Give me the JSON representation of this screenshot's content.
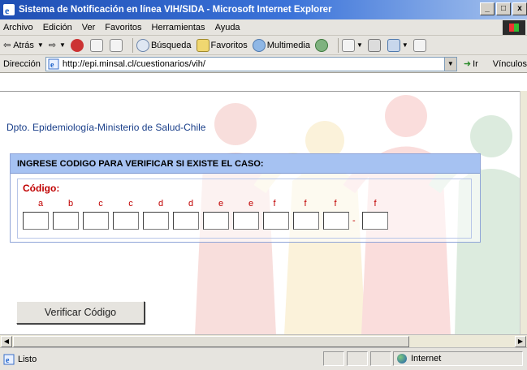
{
  "window": {
    "title": "Sistema de Notificación en línea VIH/SIDA - Microsoft Internet Explorer",
    "controls": [
      "_",
      "□",
      "x"
    ]
  },
  "menu": {
    "items": [
      {
        "label": "Archivo"
      },
      {
        "label": "Edición"
      },
      {
        "label": "Ver"
      },
      {
        "label": "Favoritos"
      },
      {
        "label": "Herramientas"
      },
      {
        "label": "Ayuda"
      }
    ]
  },
  "toolbar": {
    "back_label": "Atrás",
    "search_label": "Búsqueda",
    "favorites_label": "Favoritos",
    "multimedia_label": "Multimedia"
  },
  "address": {
    "label": "Dirección",
    "url": "http://epi.minsal.cl/cuestionarios/vih/",
    "go_label": "Ir",
    "links_label": "Vínculos"
  },
  "page": {
    "department": "Dpto. Epidemiología-Ministerio de Salud-Chile",
    "panel_title": "INGRESE CODIGO PARA VERIFICAR SI EXISTE EL CASO:",
    "code_label": "Código:",
    "code_letters": [
      "a",
      "b",
      "c",
      "c",
      "d",
      "d",
      "e",
      "e",
      "f",
      "f",
      "f",
      "f"
    ],
    "separator": "-",
    "verify_button": "Verificar Código"
  },
  "status": {
    "text": "Listo",
    "zone": "Internet"
  },
  "colors": {
    "title_bar": "#1f4fb4",
    "panel_header": "#a6c2f2",
    "code_red": "#c00000",
    "department_blue": "#1a3f8a"
  }
}
